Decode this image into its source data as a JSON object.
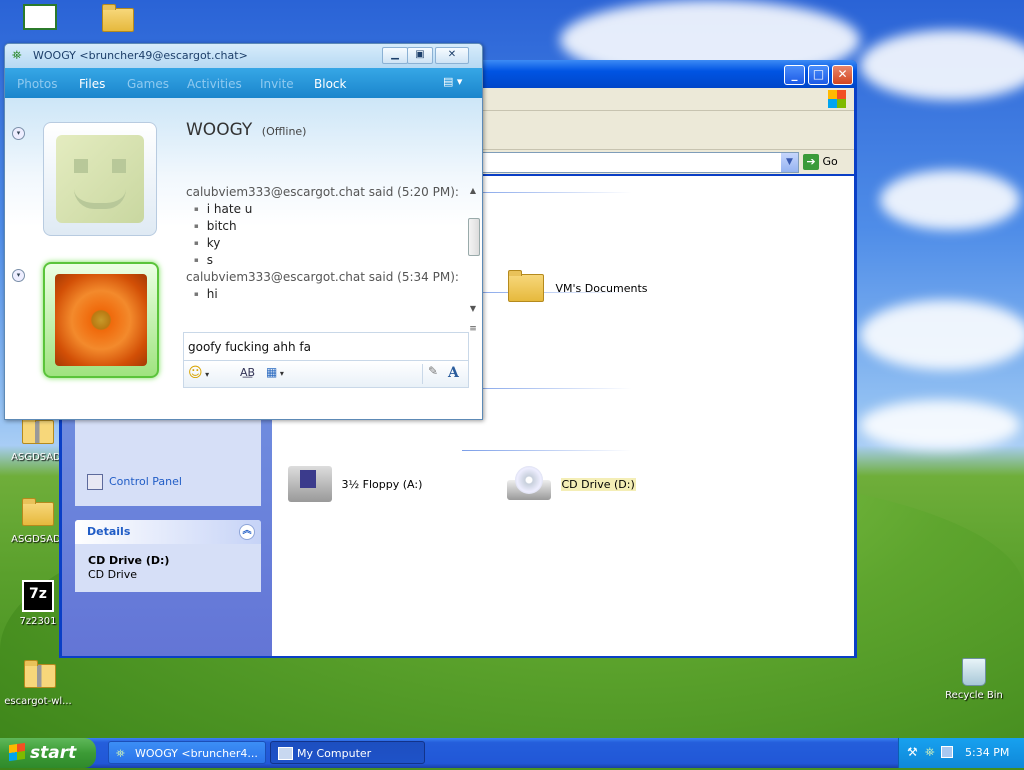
{
  "desktop": {
    "icons": [
      {
        "label": "ASGDSAD",
        "icon": "zip-folder-icon"
      },
      {
        "label": "ASGDSAD",
        "icon": "folder-icon"
      },
      {
        "label": "7z2301",
        "icon": "7zip-icon"
      },
      {
        "label": "escargot-wl...",
        "icon": "zip-folder-icon"
      },
      {
        "label": "Recycle Bin",
        "icon": "recycle-bin-icon"
      }
    ]
  },
  "my_computer": {
    "address_go": "Go",
    "items": [
      {
        "label": "VM's Documents",
        "icon": "folder-icon"
      },
      {
        "label": "3½ Floppy (A:)",
        "icon": "floppy-drive-icon"
      },
      {
        "label": "CD Drive (D:)",
        "icon": "cd-drive-icon",
        "selected": true
      }
    ],
    "other_places_item": "Control Panel",
    "details": {
      "title": "Details",
      "name": "CD Drive (D:)",
      "type": "CD Drive"
    }
  },
  "messenger": {
    "title": "WOOGY <bruncher49@escargot.chat>",
    "nav": [
      "Photos",
      "Files",
      "Games",
      "Activities",
      "Invite",
      "Block"
    ],
    "contact_name": "WOOGY",
    "contact_status": "(Offline)",
    "conversation": [
      {
        "said": "calubviem333@escargot.chat said (5:20 PM):",
        "lines": [
          "i hate u",
          "bitch",
          "ky",
          "s"
        ]
      },
      {
        "said": "calubviem333@escargot.chat said (5:34 PM):",
        "lines": [
          "hi"
        ]
      }
    ],
    "input_text": "goofy fucking ahh fa",
    "font_button": "A"
  },
  "taskbar": {
    "start_label": "start",
    "tasks": [
      "WOOGY <bruncher4...",
      "My Computer"
    ],
    "clock": "5:34 PM"
  },
  "colors": {
    "taskbar": "#245edb",
    "start": "#3c9b36",
    "messenger_nav": "#1b85cc"
  }
}
